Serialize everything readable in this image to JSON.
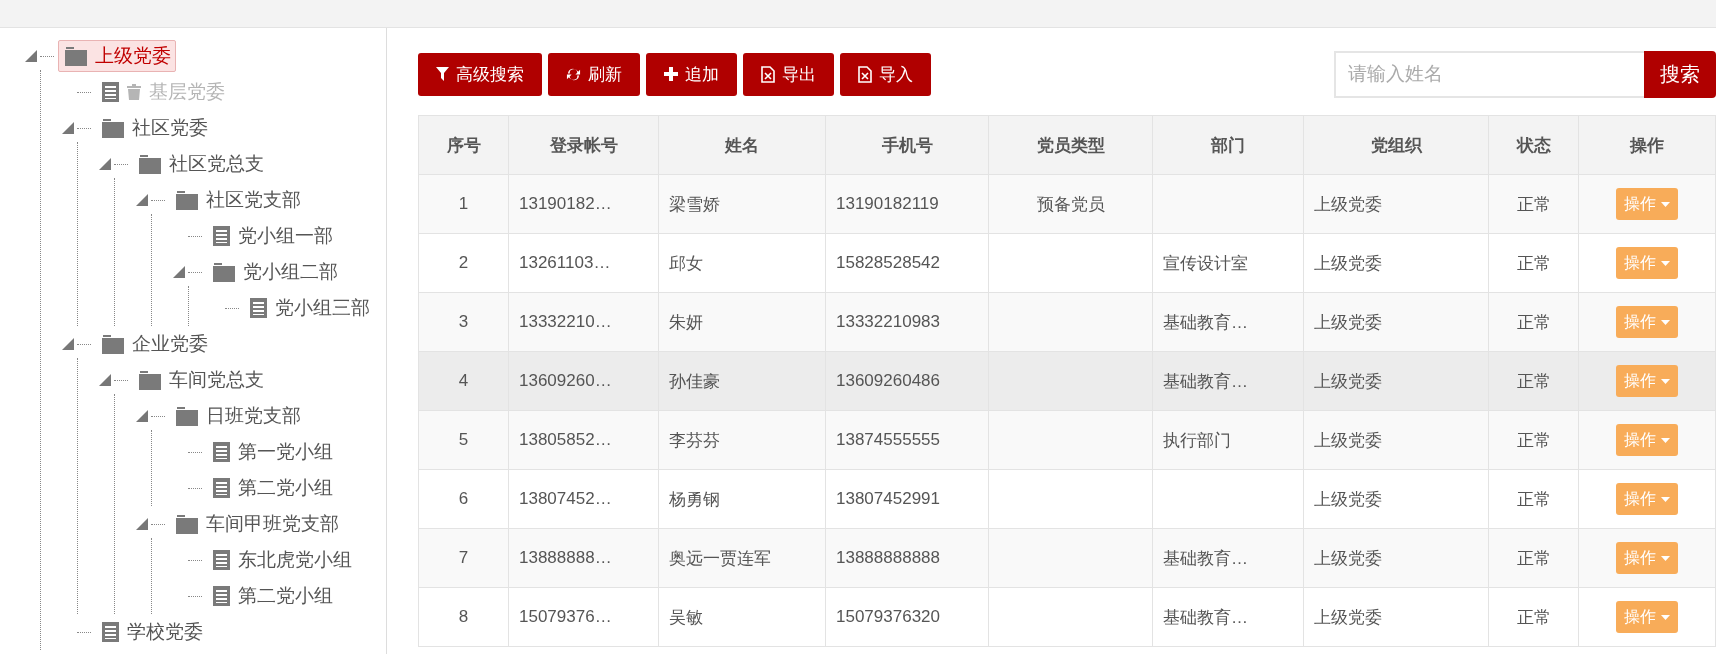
{
  "tree": {
    "items": [
      {
        "label": "上级党委",
        "kind": "folder",
        "selected": true,
        "disabled": false,
        "expanded": true,
        "children": [
          {
            "label": "基层党委",
            "kind": "file",
            "selected": false,
            "disabled": true
          },
          {
            "label": "社区党委",
            "kind": "folder",
            "selected": false,
            "disabled": false,
            "expanded": true,
            "children": [
              {
                "label": "社区党总支",
                "kind": "folder",
                "selected": false,
                "disabled": false,
                "expanded": true,
                "children": [
                  {
                    "label": "社区党支部",
                    "kind": "folder",
                    "selected": false,
                    "disabled": false,
                    "expanded": true,
                    "children": [
                      {
                        "label": "党小组一部",
                        "kind": "file",
                        "selected": false,
                        "disabled": false
                      },
                      {
                        "label": "党小组二部",
                        "kind": "folder",
                        "selected": false,
                        "disabled": false,
                        "expanded": true,
                        "children": [
                          {
                            "label": "党小组三部",
                            "kind": "file",
                            "selected": false,
                            "disabled": false
                          }
                        ]
                      }
                    ]
                  }
                ]
              }
            ]
          },
          {
            "label": "企业党委",
            "kind": "folder",
            "selected": false,
            "disabled": false,
            "expanded": true,
            "children": [
              {
                "label": "车间党总支",
                "kind": "folder",
                "selected": false,
                "disabled": false,
                "expanded": true,
                "children": [
                  {
                    "label": "日班党支部",
                    "kind": "folder",
                    "selected": false,
                    "disabled": false,
                    "expanded": true,
                    "children": [
                      {
                        "label": "第一党小组",
                        "kind": "file",
                        "selected": false,
                        "disabled": false
                      },
                      {
                        "label": "第二党小组",
                        "kind": "file",
                        "selected": false,
                        "disabled": false
                      }
                    ]
                  },
                  {
                    "label": "车间甲班党支部",
                    "kind": "folder",
                    "selected": false,
                    "disabled": false,
                    "expanded": true,
                    "children": [
                      {
                        "label": "东北虎党小组",
                        "kind": "file",
                        "selected": false,
                        "disabled": false
                      },
                      {
                        "label": "第二党小组",
                        "kind": "file",
                        "selected": false,
                        "disabled": false
                      }
                    ]
                  }
                ]
              }
            ]
          },
          {
            "label": "学校党委",
            "kind": "file",
            "selected": false,
            "disabled": false
          }
        ]
      }
    ]
  },
  "toolbar": {
    "buttons": [
      {
        "label": "高级搜索",
        "kind": "filter"
      },
      {
        "label": "刷新",
        "kind": "refresh"
      },
      {
        "label": "追加",
        "kind": "add"
      },
      {
        "label": "导出",
        "kind": "excel"
      },
      {
        "label": "导入",
        "kind": "excel"
      }
    ],
    "search": {
      "placeholder": "请输入姓名",
      "button": "搜索"
    }
  },
  "table": {
    "columns": [
      "序号",
      "登录帐号",
      "姓名",
      "手机号",
      "党员类型",
      "部门",
      "党组织",
      "状态",
      "操作"
    ],
    "rows": [
      {
        "selected": false,
        "cells": [
          "1",
          "13190182…",
          "梁雪娇",
          "13190182119",
          "预备党员",
          "",
          "上级党委",
          "正常"
        ],
        "action": "操作"
      },
      {
        "selected": false,
        "cells": [
          "2",
          "13261103…",
          "邱女",
          "15828528542",
          "",
          "宣传设计室",
          "上级党委",
          "正常"
        ],
        "action": "操作"
      },
      {
        "selected": false,
        "cells": [
          "3",
          "13332210…",
          "朱妍",
          "13332210983",
          "",
          "基础教育…",
          "上级党委",
          "正常"
        ],
        "action": "操作"
      },
      {
        "selected": true,
        "cells": [
          "4",
          "13609260…",
          "孙佳豪",
          "13609260486",
          "",
          "基础教育…",
          "上级党委",
          "正常"
        ],
        "action": "操作"
      },
      {
        "selected": false,
        "cells": [
          "5",
          "13805852…",
          "李芬芬",
          "13874555555",
          "",
          "执行部门",
          "上级党委",
          "正常"
        ],
        "action": "操作"
      },
      {
        "selected": false,
        "cells": [
          "6",
          "13807452…",
          "杨勇钢",
          "13807452991",
          "",
          "",
          "上级党委",
          "正常"
        ],
        "action": "操作"
      },
      {
        "selected": false,
        "cells": [
          "7",
          "13888888…",
          "奥远一贾连军",
          "13888888888",
          "",
          "基础教育…",
          "上级党委",
          "正常"
        ],
        "action": "操作"
      },
      {
        "selected": false,
        "cells": [
          "8",
          "15079376…",
          "吴敏",
          "15079376320",
          "",
          "基础教育…",
          "上级党委",
          "正常"
        ],
        "action": "操作"
      }
    ]
  }
}
